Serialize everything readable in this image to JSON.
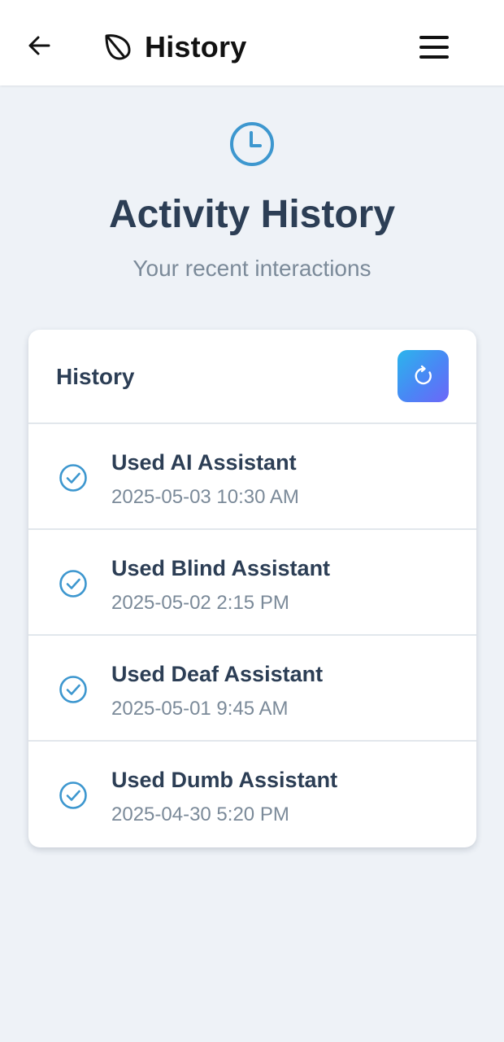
{
  "app": {
    "title": "History"
  },
  "icons": {
    "back": "arrow-left-icon",
    "logo": "leaf-icon",
    "menu": "hamburger-menu-icon",
    "hero": "clock-icon",
    "refresh": "refresh-icon",
    "item": "check-circle-icon"
  },
  "colors": {
    "accent": "#3d97cf",
    "heading": "#2c3e55",
    "muted": "#7b8a99",
    "background": "#eef2f7"
  },
  "page": {
    "heading": "Activity History",
    "subheading": "Your recent interactions"
  },
  "history_card": {
    "title": "History",
    "items": [
      {
        "label": "Used AI Assistant",
        "time": "2025-05-03 10:30 AM"
      },
      {
        "label": "Used Blind Assistant",
        "time": "2025-05-02 2:15 PM"
      },
      {
        "label": "Used Deaf Assistant",
        "time": "2025-05-01 9:45 AM"
      },
      {
        "label": "Used Dumb Assistant",
        "time": "2025-04-30 5:20 PM"
      }
    ]
  }
}
